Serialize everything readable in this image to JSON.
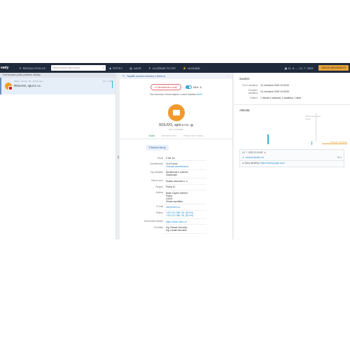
{
  "topbar": {
    "brand": "eady",
    "items": [
      {
        "icon": "list-icon",
        "label": "RESOLUTION.CZ"
      },
      {
        "icon": "tag-icon",
        "label": "ŠTÍTKY"
      },
      {
        "icon": "grid-icon",
        "label": "AKCE"
      },
      {
        "icon": "filter-icon",
        "label": "ULOŽENÉ FILTRY"
      },
      {
        "icon": "bolt-icon",
        "label": "HLEDÁNÍ"
      }
    ],
    "search_placeholder": "Hledat jméno nebo email",
    "date_range": "11. 6. — 10. 7. 2023",
    "credit": "ZBÝVÁ 465 KREDITŮ"
  },
  "list": {
    "header": "Konverzace podle poslední aktivity",
    "conversation": {
      "meta": "Sklad · 20 min. 45 · 10:13 ukon.",
      "time": "10. 7. 2023",
      "name": "ROLIVO, spol.s r.o."
    }
  },
  "contact": {
    "notice": "Napište podobní bannery z Merk.cz",
    "unsubscribe": "Neodebírat e-mail",
    "toggle_label": "Merk",
    "toggle_value": "A",
    "info_note": "Více informací k firmě najdete v online databázi",
    "info_link": "Merk.",
    "company": "ROLIVO, spol.s r.o.",
    "company_id": "IČO: 27123825",
    "tabs": [
      "LEAD",
      "OPPORTUNITY",
      "PŘIDAT DO STUDIE"
    ],
    "section": "Přehled firmy",
    "fields": [
      {
        "k": "Obrat",
        "v": [
          "3 mil. Kč"
        ]
      },
      {
        "k": "Zaměstnanci",
        "v": [
          "10-19 osob"
        ],
        "link": "Zobrazit zaměstnance"
      },
      {
        "k": "Typ subjektu",
        "v": [
          "Společnost s ručením",
          "omezeným"
        ]
      },
      {
        "k": "Hlavní obor",
        "v": [
          "Služby obchodní s. o."
        ]
      },
      {
        "k": "Region",
        "v": [
          "Praha 10"
        ]
      },
      {
        "k": "Adresa",
        "v": [
          "Bratří Čapků 1084/10",
          "Praha",
          "10100",
          "Česká republika"
        ]
      },
      {
        "k": "E-mail",
        "link": "info@rolivo.cz"
      },
      {
        "k": "Telefon",
        "link": "+420 222 986 761 (52.9%)",
        "link2": "+420 222 986 761 (52.9%)"
      },
      {
        "k": "Domovská stránka",
        "link": "https://www.rolivo.cz"
      },
      {
        "k": "Kontakty",
        "v": [
          "Ing. Roman Novotný,",
          "Ing. Libuše Novotná"
        ]
      }
    ]
  },
  "summary": {
    "title": "Souhrn",
    "rows": [
      {
        "k": "První návštěva",
        "v": "10. července 2023 10:19:53"
      },
      {
        "k": "Poslední návštěva",
        "v": "10. července 2023 10:19:53"
      },
      {
        "k": "Celkem",
        "v": "1 minuta 1 sekunda, 1 návštěva, 1 akce"
      }
    ],
    "activity_title": "Aktivita",
    "future_label": "Plánované akce",
    "future_year": "2023",
    "orange_label": "Poslední návštěva",
    "event": {
      "date": "10. 7. 2023 10:19:53",
      "tag": "⊕",
      "url": "www.resolution.cz/",
      "duration": "61 s",
      "source_label": "Zdroj návštěvy:",
      "source_link": "https://www.google.com/"
    }
  }
}
